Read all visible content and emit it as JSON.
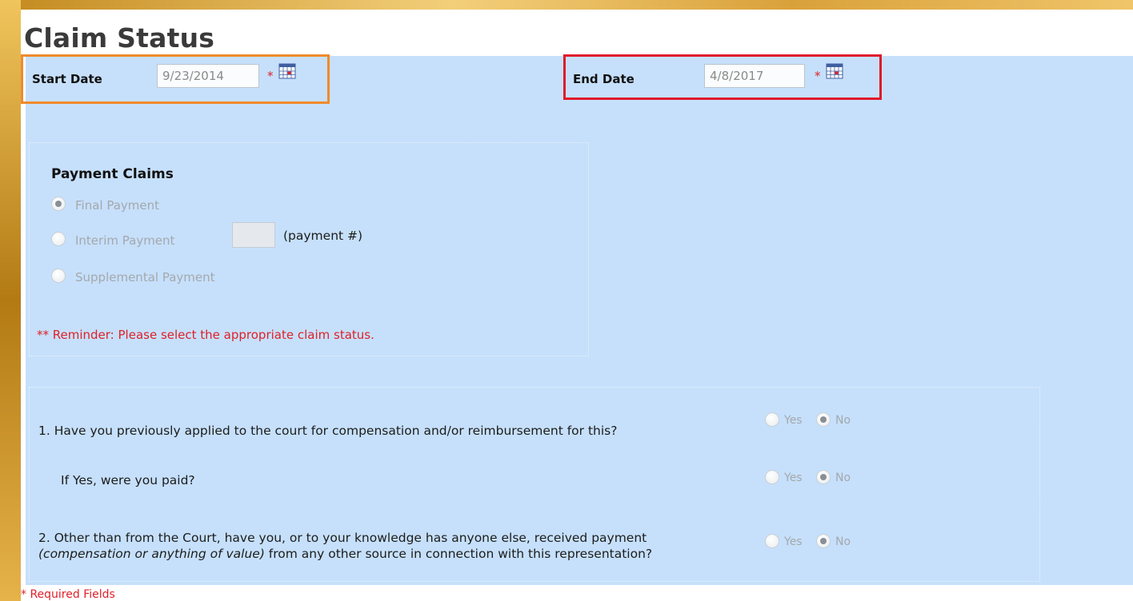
{
  "page": {
    "title": "Claim Status"
  },
  "dates": {
    "start": {
      "label": "Start Date",
      "value": "9/23/2014",
      "required_mark": "*"
    },
    "end": {
      "label": "End Date",
      "value": "4/8/2017",
      "required_mark": "*"
    }
  },
  "payment_claims": {
    "heading": "Payment Claims",
    "options": [
      {
        "label": "Final Payment",
        "selected": true
      },
      {
        "label": "Interim Payment",
        "selected": false
      },
      {
        "label": "Supplemental Payment",
        "selected": false
      }
    ],
    "payment_number_hint": "(payment #)",
    "reminder": "** Reminder: Please select the appropriate claim status."
  },
  "questions": {
    "q1": {
      "text": "1. Have you previously applied to the court for compensation and/or reimbursement for this?",
      "yes": "Yes",
      "no": "No",
      "selected": "No"
    },
    "q1a": {
      "text": "If Yes, were you paid?",
      "yes": "Yes",
      "no": "No",
      "selected": "No"
    },
    "q2": {
      "text_line1": "2. Other than from the Court, have you, or to your knowledge has anyone else, received payment",
      "text_line2_italic": "(compensation or anything of value)",
      "text_line2_rest": " from any other source in connection with this representation?",
      "yes": "Yes",
      "no": "No",
      "selected": "No"
    }
  },
  "footer": {
    "required_note": "* Required Fields"
  },
  "colors": {
    "panel": "#c6e0fb",
    "highlight_start": "#f08a2c",
    "highlight_end": "#e01a2c",
    "required": "#e0202a"
  },
  "icons": {
    "calendar": "calendar-icon"
  }
}
